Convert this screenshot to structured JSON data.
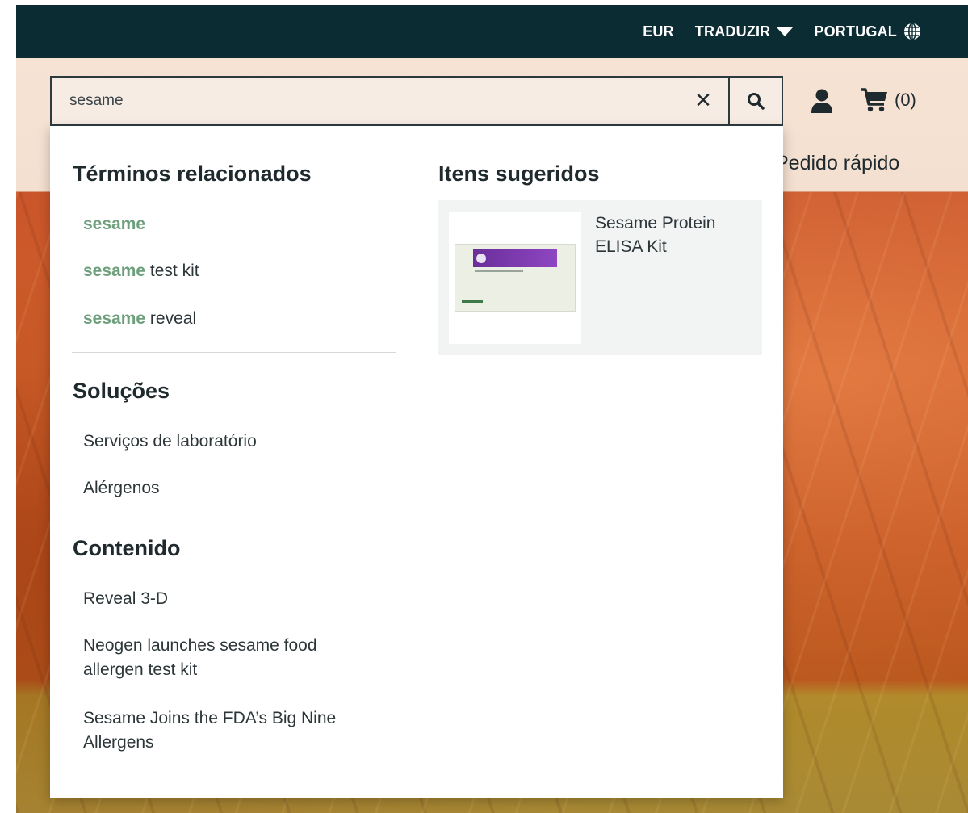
{
  "topbar": {
    "currency": "EUR",
    "translate": "TRADUZIR",
    "country": "PORTUGAL"
  },
  "search": {
    "value": "sesame",
    "placeholder": ""
  },
  "header": {
    "cart_count": "(0)",
    "quick_order": "Pedido rápido"
  },
  "dropdown": {
    "related": {
      "title": "Términos relacionados",
      "items": [
        {
          "highlight": "sesame",
          "rest": ""
        },
        {
          "highlight": "sesame",
          "rest": " test kit"
        },
        {
          "highlight": "sesame",
          "rest": " reveal"
        }
      ]
    },
    "solutions": {
      "title": "Soluções",
      "items": [
        "Serviços de laboratório",
        "Alérgenos"
      ]
    },
    "content": {
      "title": "Contenido",
      "items": [
        "Reveal 3-D",
        "Neogen launches sesame food allergen test kit",
        "Sesame Joins the FDA’s Big Nine Allergens"
      ]
    },
    "suggested": {
      "title": "Itens sugeridos",
      "items": [
        {
          "name": "Sesame Protein ELISA Kit"
        }
      ]
    }
  },
  "colors": {
    "topbar_bg": "#0c2c33",
    "highlight": "#6e9f7d",
    "hero_orange": "#c9552a"
  },
  "icons": {
    "globe": "globe-icon",
    "caret": "caret-down-icon",
    "clear": "close-icon",
    "search": "search-icon",
    "user": "user-icon",
    "cart": "cart-icon"
  }
}
